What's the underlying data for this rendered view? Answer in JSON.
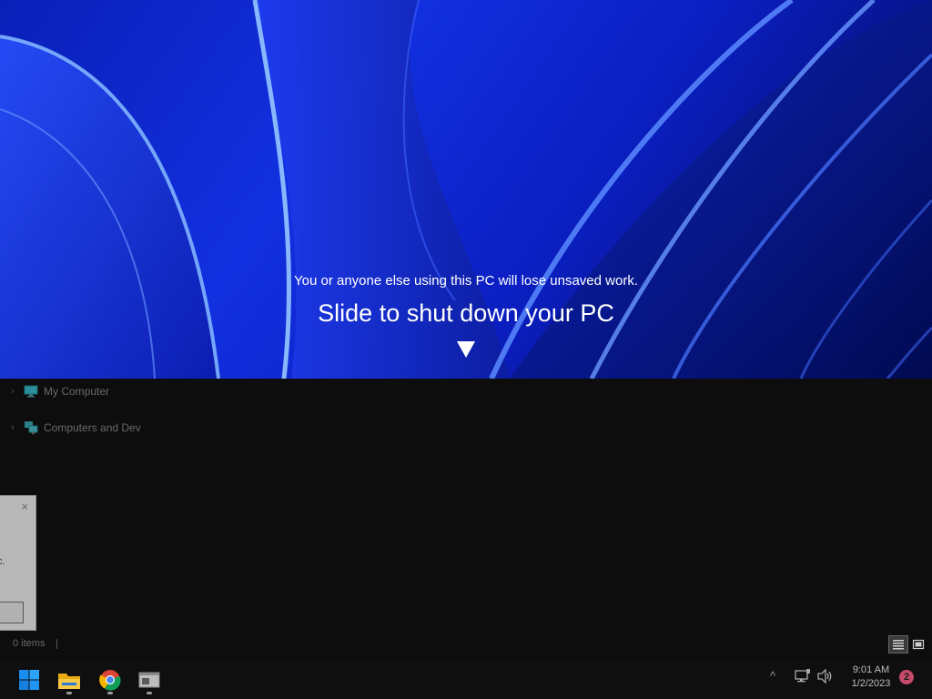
{
  "explorer": {
    "tree": [
      {
        "label": "My Computer",
        "icon": "monitor-icon"
      },
      {
        "label": "Computers and Dev",
        "icon": "network-computers-icon"
      }
    ],
    "dialog": {
      "close": "×",
      "text": "c."
    },
    "status": {
      "item_count": "0 items"
    }
  },
  "shutdown": {
    "warning": "You or anyone else using this PC will lose unsaved work.",
    "title": "Slide to shut down your PC",
    "arrow_icon": "down-triangle-icon"
  },
  "taskbar": {
    "apps": [
      {
        "name": "Start",
        "icon": "windows-logo-icon"
      },
      {
        "name": "File Explorer",
        "icon": "folder-icon"
      },
      {
        "name": "Google Chrome",
        "icon": "chrome-icon"
      },
      {
        "name": "App Window",
        "icon": "window-app-icon"
      }
    ],
    "tray": {
      "chevron": "^",
      "time": "9:01 AM",
      "date": "1/2/2023",
      "notification_count": "2"
    }
  },
  "colors": {
    "wallpaper_blue": "#1230e0",
    "taskbar_bg": "#0f0f0f",
    "badge": "#c54a6a"
  }
}
